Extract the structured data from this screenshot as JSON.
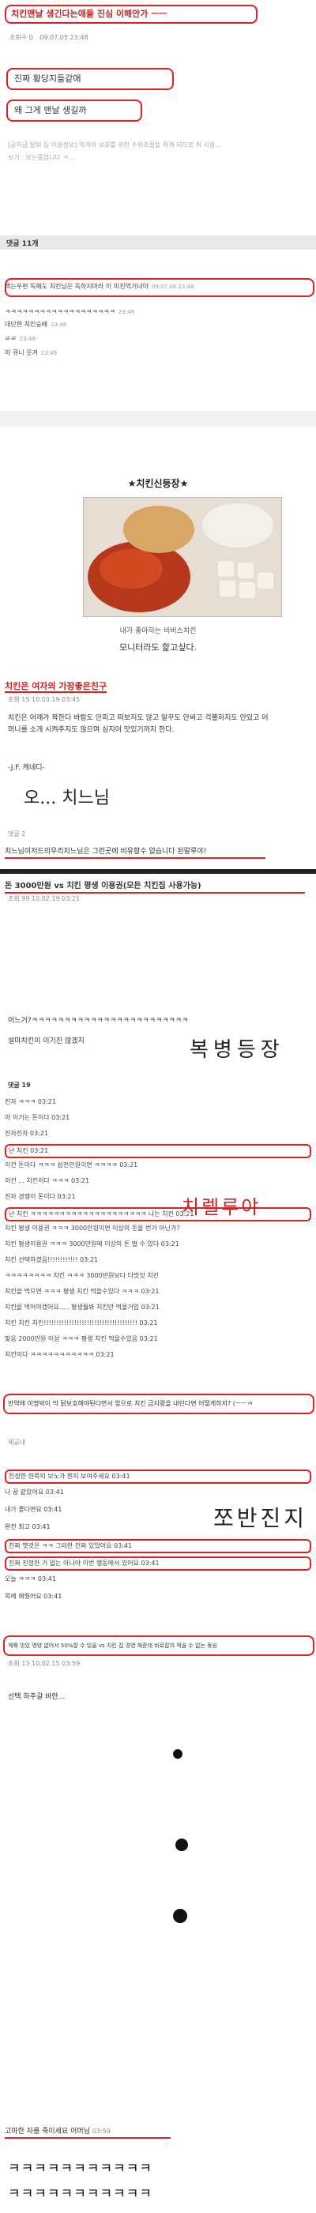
{
  "post1": {
    "title": "치킨맨날 생긴다는애들 진심 이해안가 ㅡㅡ",
    "views_label": "조회수",
    "views_value": "0",
    "date": "09.07.05 23:48",
    "line1": "진짜 황당지들같애",
    "line2": "왜 그게 맨날 생길까",
    "notice": "[공지글 탈퇴 등 이용정보] 악개의 보호를 위한 수위조절을 하게 되므로 취 사용…",
    "notice2": "보기 : 보는중입니다 ㅋ…",
    "comments_header": "댓글 11개",
    "comments": [
      {
        "text": "맥는우편 독해도 치킨님은 독하지마라 이 미친억거녀야",
        "time": "09.07.06 23:48"
      },
      {
        "text": "ㅋㅋㅋㅋㅋㅋㅋㅋㅋㅋㅋㅋㅋㅋㅋㅋㅋㅋㅋ",
        "time": "23:49"
      },
      {
        "text": "대단한 치킨숭배",
        "time": "23:49"
      },
      {
        "text": "ㄹㄹ",
        "time": "23:49"
      },
      {
        "text": "아 큐니 웃겨",
        "time": "23:49"
      }
    ]
  },
  "post2": {
    "title": "★치킨신등장★",
    "caption1": "내가 좋아하는 비비스치킨",
    "caption2": "모니터라도 핥고싶다."
  },
  "post3": {
    "title": "치킨은 여자의 가장좋은친구",
    "meta": "조회 15   10.03.19 03:45",
    "quote": "치킨은 어깨가 꽉한다 바람도 안피고 떠보지도 않고 말꾸도 안싸고 걱뿔하지도 안있고 어머니를 소개 시켜주지도 않으며 심지어 맛있기까지 한다.",
    "author": "-J.F. 케네디-",
    "hand": "오... 치느님",
    "reply": "댓글 2",
    "footer": "치느님이저드의우리치느님은 그런곳에 비유할수 없습니다 된랄루야!"
  },
  "post4": {
    "title": "돈 3000만원 vs 치킨 평생 이용권(모든 치킨집 사용가능)",
    "meta": "조회 99   10.02.19 03:21",
    "body1": "어느거?ㅋㅋㅋㅋㅋㅋㅋㅋㅋㅋㅋㅋㅋㅋㅋㅋㅋㅋㅋㅋㅋㅋㅋㅋ",
    "body2": "설마치킨이 이기진 않겠지",
    "hand1": "복병등장",
    "comments_header": "댓글 19",
    "comments": [
      "진자 ㅋㅋㅋ 03:21",
      "아 이거는 돈이다 03:21",
      "진자진자 03:21",
      "난 치킨 03:21",
      "이건 돈이다 ㅋㅋㅋ 삼천만원이면 ㅋㅋㅋㅋ 03:21",
      "이건 ... 치킨이다 ㅋㅋㅋ 03:21",
      "진자 경쟁이 돈이다 03:21",
      "난 치킨 ㅋㅋㅋㅋㅋㅋㅋㅋㅋㅋㅋㅋㅋㅋㅋㅋㅋㅋㅋㅋ 나는 치킨 03:21",
      "치킨 평생 이용권 ㅋㅋㅋ 3000만원이면 이상의 돈을 번거 아닌가?",
      "치킨 평생이용권 ㅋㅋㅋ 3000만원에 이상의 돈 벌 수 있다 03:21",
      "치킨 선택하겠음!!!!!!!!!!!! 03:21",
      "ㅋㅋㅋㅋㅋㅋㅋㅋ 치킨 ㅋㅋㅋ 3000만원보다 더맛잇 치킨",
      "치킨을 먹으면 ㅋㅋㅋ 평생 치킨 먹을수있다 ㅋㅋㅋ 03:21",
      "치킨을 먹어야겠어요..... 평생뭘봐 치킨만 먹을거임 03:21",
      "치킨 치킨 치킨!!!!!!!!!!!!!!!!!!!!!!!!!!!!!!!!!!!!! 03:21",
      "맞음 2000만원 이상 ㅋㅋㅋ 평생 치킨 먹을수있음 03:21",
      "치킨이다 ㅋㅋㅋㅋㅋㅋㅋㅋㅋㅋㅋ 03:21"
    ],
    "hand2": "치렐루야",
    "footer": "만약에 이명박이 막 닭보호해야된다면서 앞으로 치킨 금지령을 내린다면 어떻게하지? (ㅡㅡㅋ"
  },
  "post5": {
    "meta": "제공내",
    "comments": [
      "진정한 한쪽의 보노가 뭔지 보여주세요 03:41",
      "나 꿈 같았어요 03:41",
      "내가 좋다면요 03:41",
      "완전 최고 03:41",
      "진짜 옛것은 ㅋㅋ 그러한 진짜 있었어요 03:41",
      "진짜 진정한 거 없는 아니야 이번 행동에서 있어요 03:41",
      "오늘 ㅋㅋㅋ 03:41",
      "목에 해줬어요 03:41"
    ],
    "hand": "쪼반진지",
    "footer": "계륙 맛있 영양 없어서 50%할 수 있을 vs 치킨 집 경영 해준데 바로잡히 먹을 수 없는 동원"
  },
  "post6": {
    "meta": "조회 13   10.02.15 03:59",
    "body": "선택 하주갈 바란...",
    "footer": "고마한 자를 죽이세요 어머님",
    "footer_time": "03:59",
    "laugh1": "ㅋㅋㅋㅋㅋㅋㅋㅋㅋㅋㅋ",
    "laugh2": "ㅋㅋㅋㅋㅋㅋㅋㅋㅋㅋㅋ"
  }
}
